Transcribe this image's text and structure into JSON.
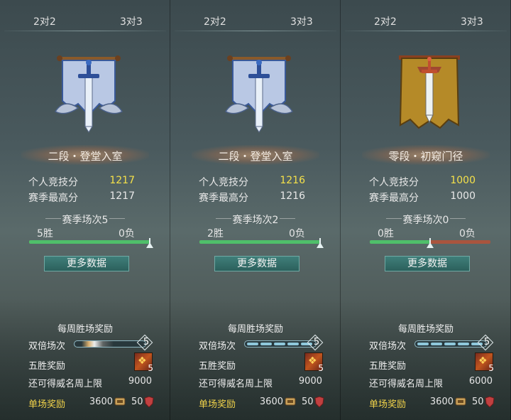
{
  "colors": {
    "highlight_score": "#f5e14a",
    "win_bar": "#4fbf6a",
    "loss_bar": "#a9553e",
    "button_bg": "#2c605c",
    "reward_label": "#f0d24a"
  },
  "panels": [
    {
      "tabs": {
        "two": "2对2",
        "three": "3对3"
      },
      "emblem": "silver-banner-sword-emblem",
      "rank_name": "二段・登堂入室",
      "score_label": "个人竞技分",
      "score": "1217",
      "best_label": "赛季最高分",
      "best": "1217",
      "season_label": "赛季场次5",
      "wins": "5胜",
      "losses": "0负",
      "win_fraction": 1.0,
      "more_button": "更多数据",
      "weekly_title": "每周胜场奖励",
      "double_label": "双倍场次",
      "double_count": "5",
      "five_win_label": "五胜奖励",
      "five_win_count": "5",
      "weimin_label": "还可得威名周上限",
      "weimin_value": "9000",
      "single_label": "单场奖励",
      "single_money": "3600",
      "single_rep": "50"
    },
    {
      "tabs": {
        "two": "2对2",
        "three": "3对3"
      },
      "emblem": "silver-banner-sword-emblem",
      "rank_name": "二段・登堂入室",
      "score_label": "个人竞技分",
      "score": "1216",
      "best_label": "赛季最高分",
      "best": "1216",
      "season_label": "赛季场次2",
      "wins": "2胜",
      "losses": "0负",
      "win_fraction": 1.0,
      "more_button": "更多数据",
      "weekly_title": "每周胜场奖励",
      "double_label": "双倍场次",
      "double_count": "5",
      "five_win_label": "五胜奖励",
      "five_win_count": "5",
      "weimin_label": "还可得威名周上限",
      "weimin_value": "9000",
      "single_label": "单场奖励",
      "single_money": "3600",
      "single_rep": "50"
    },
    {
      "tabs": {
        "two": "2对2",
        "three": "3对3"
      },
      "emblem": "gold-banner-sword-emblem",
      "rank_name": "零段・初窥门径",
      "score_label": "个人竞技分",
      "score": "1000",
      "best_label": "赛季最高分",
      "best": "1000",
      "season_label": "赛季场次0",
      "wins": "0胜",
      "losses": "0负",
      "win_fraction": 0.5,
      "more_button": "更多数据",
      "weekly_title": "每周胜场奖励",
      "double_label": "双倍场次",
      "double_count": "5",
      "five_win_label": "五胜奖励",
      "five_win_count": "5",
      "weimin_label": "还可得威名周上限",
      "weimin_value": "6000",
      "single_label": "单场奖励",
      "single_money": "3600",
      "single_rep": "50"
    }
  ]
}
